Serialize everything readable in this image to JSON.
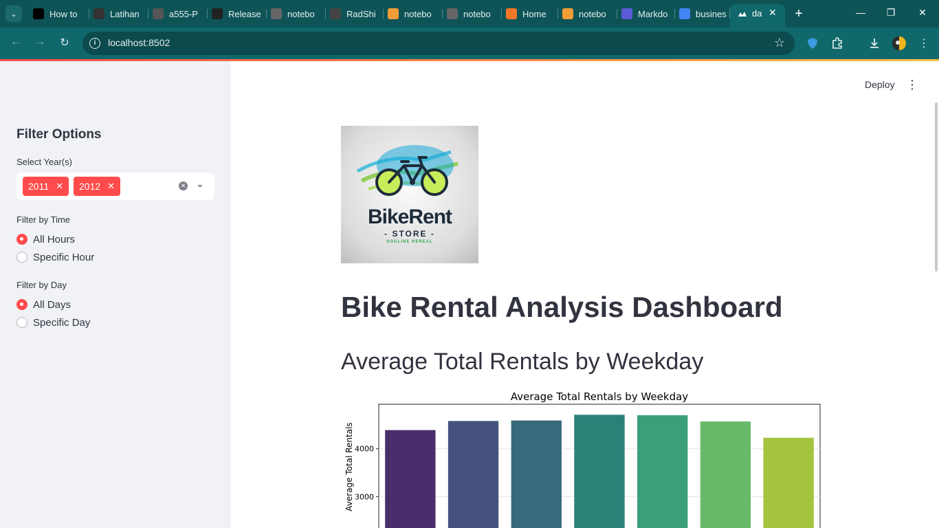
{
  "browser": {
    "tabs": [
      {
        "label": "How to",
        "icon": "medium-icon",
        "color": "#000000"
      },
      {
        "label": "Latihan",
        "icon": "g-icon",
        "color": "#333333"
      },
      {
        "label": "a555-P",
        "icon": "loading-icon",
        "color": "#555555"
      },
      {
        "label": "Release",
        "icon": "github-icon",
        "color": "#222222"
      },
      {
        "label": "notebo",
        "icon": "globe-icon",
        "color": "#666666"
      },
      {
        "label": "RadShi",
        "icon": "chatgpt-icon",
        "color": "#444444"
      },
      {
        "label": "notebo",
        "icon": "book-icon",
        "color": "#f29d38"
      },
      {
        "label": "notebo",
        "icon": "globe-icon",
        "color": "#666666"
      },
      {
        "label": "Home",
        "icon": "jupyter-icon",
        "color": "#f37726"
      },
      {
        "label": "notebo",
        "icon": "book-icon",
        "color": "#f29d38"
      },
      {
        "label": "Markdo",
        "icon": "markdown-icon",
        "color": "#5b5bd6"
      },
      {
        "label": "busines",
        "icon": "google-icon",
        "color": "#4285f4"
      }
    ],
    "active_tab": {
      "label": "da",
      "icon": "streamlit-icon"
    },
    "url": "localhost:8502"
  },
  "sidebar": {
    "title": "Filter Options",
    "year_label": "Select Year(s)",
    "selected_years": [
      "2011",
      "2012"
    ],
    "time_label": "Filter by Time",
    "time_options": [
      "All Hours",
      "Specific Hour"
    ],
    "time_selected": 0,
    "day_label": "Filter by Day",
    "day_options": [
      "All Days",
      "Specific Day"
    ],
    "day_selected": 0
  },
  "main": {
    "deploy_label": "Deploy",
    "logo": {
      "line1": "BikeRent",
      "line2": "- STORE -",
      "line3": "SOGLINE REREAL"
    },
    "title": "Bike Rental Analysis Dashboard",
    "section_title": "Average Total Rentals by Weekday"
  },
  "chart_data": {
    "type": "bar",
    "title": "Average Total Rentals by Weekday",
    "ylabel": "Average Total Rentals",
    "xlabel": "",
    "categories": [
      "",
      "",
      "",
      "",
      "",
      "",
      ""
    ],
    "values": [
      4390,
      4580,
      4590,
      4710,
      4700,
      4570,
      4230
    ],
    "colors": [
      "#4a2e6b",
      "#46527e",
      "#376a7b",
      "#2b8078",
      "#3ba07a",
      "#69b96a",
      "#a4c440"
    ],
    "yticks": [
      3000,
      4000
    ],
    "ylim_visible": [
      2200,
      4930
    ],
    "grid": true
  }
}
